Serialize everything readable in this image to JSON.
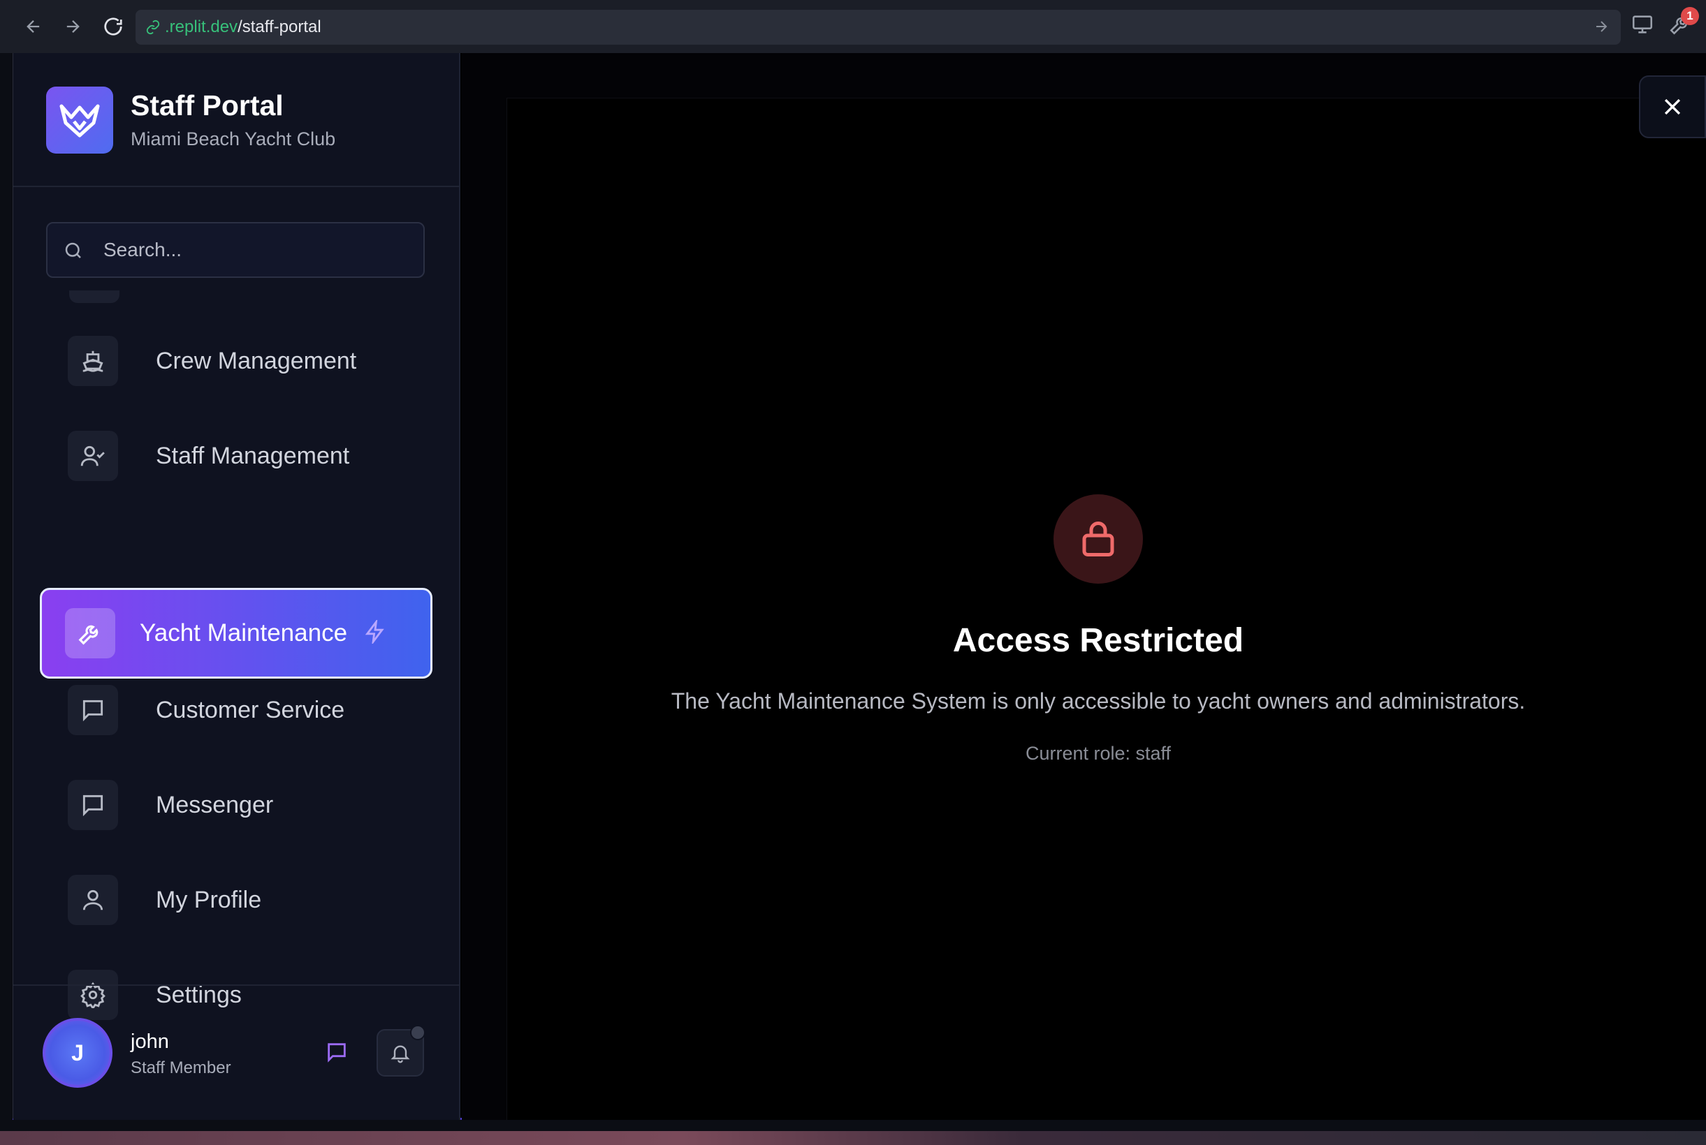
{
  "browser": {
    "url_host": ".replit.dev",
    "url_path": "/staff-portal",
    "extension_badge": "1"
  },
  "brand": {
    "title": "Staff Portal",
    "subtitle": "Miami Beach Yacht Club"
  },
  "search": {
    "placeholder": "Search..."
  },
  "nav": {
    "items": [
      {
        "label": "Crew Management",
        "icon": "ship-icon"
      },
      {
        "label": "Staff Management",
        "icon": "user-check-icon"
      },
      {
        "label": "Yacht Maintenance",
        "icon": "wrench-icon",
        "active": true
      },
      {
        "label": "Customer Service",
        "icon": "message-square-icon"
      },
      {
        "label": "Messenger",
        "icon": "message-square-icon"
      },
      {
        "label": "My Profile",
        "icon": "user-icon"
      },
      {
        "label": "Settings",
        "icon": "gear-icon"
      }
    ]
  },
  "user": {
    "initial": "J",
    "name": "john",
    "role": "Staff Member"
  },
  "main": {
    "title": "Access Restricted",
    "message": "The Yacht Maintenance System is only accessible to yacht owners and administrators.",
    "role_line": "Current role: staff"
  },
  "colors": {
    "accent_start": "#8a3ff0",
    "accent_end": "#3f63ee",
    "lock_red": "#ef6a6a",
    "url_green": "#37c07a"
  }
}
